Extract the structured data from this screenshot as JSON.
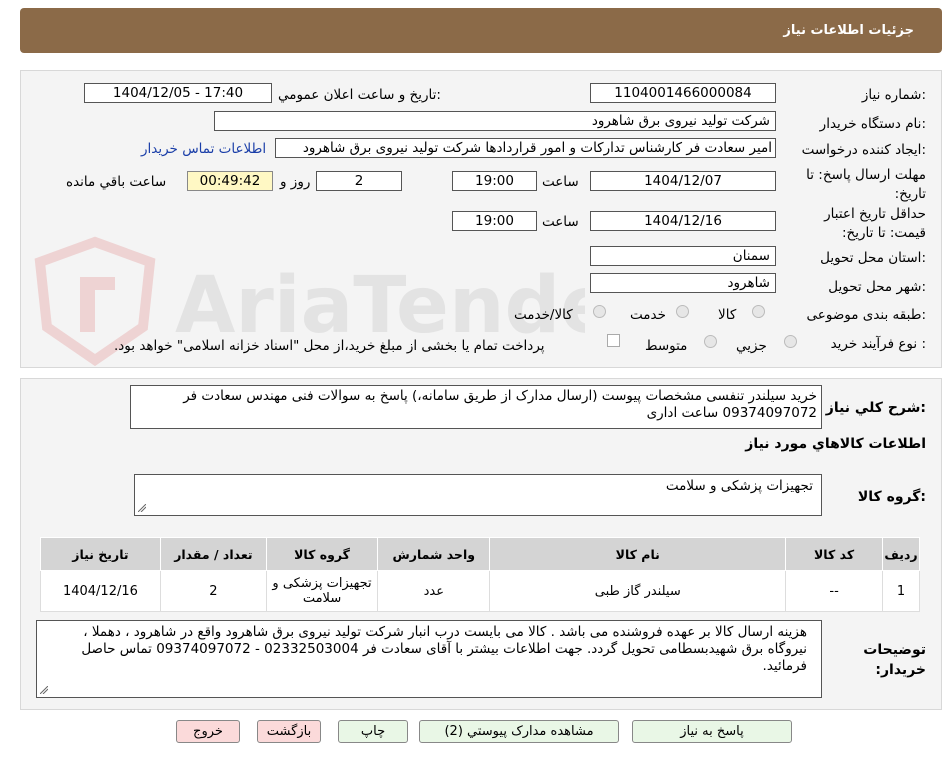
{
  "header": {
    "title": "جزئیات اطلاعات نیاز"
  },
  "watermark": {
    "text": "AriaTender.neT"
  },
  "form": {
    "need_number_label": "شماره نیاز:",
    "need_number": "1104001466000084",
    "announce_label": "تاریخ و ساعت اعلان عمومي:",
    "announce_value": "1404/12/05 - 17:40",
    "buyer_org_label": "نام دستگاه خريدار:",
    "buyer_org": "شرکت تولید نیروی برق شاهرود",
    "requester_label": "ايجاد کننده درخواست:",
    "requester": "امیر سعادت فر کارشناس تدارکات و امور قراردادها شرکت تولید نیروی برق شاهرود",
    "buyer_contact_link": "اطلاعات تماس خريدار",
    "reply_deadline_label": "مهلت ارسال پاسخ: تا تاریخ:",
    "reply_date": "1404/12/07",
    "time_label": "ساعت",
    "reply_time": "19:00",
    "days_value": "2",
    "days_label": "روز و",
    "remaining_time": "00:49:42",
    "remaining_label": "ساعت باقي مانده",
    "validity_label": "حداقل تاريخ اعتبار قيمت: تا تاريخ:",
    "validity_date": "1404/12/16",
    "validity_time": "19:00",
    "province_label": "استان محل تحويل:",
    "province": "سمنان",
    "city_label": "شهر محل تحويل:",
    "city": "شاهرود",
    "category_label": "طبقه بندی موضوعی:",
    "category_options": [
      "کالا",
      "خدمت",
      "کالا/خدمت"
    ],
    "purchase_type_label": "نوع فرآيند خريد :",
    "purchase_options": [
      "جزيي",
      "متوسط"
    ],
    "payment_note": "پرداخت تمام يا بخشی از مبلغ خريد،از محل \"اسناد خزانه اسلامی\" خواهد بود."
  },
  "summary": {
    "label": "شرح کلي نياز:",
    "text": "خرید سیلندر تنفسی مشخصات پیوست (ارسال مدارک از طریق سامانه،) پاسخ به سوالات فنی مهندس سعادت فر 09374097072 ساعت اداری"
  },
  "goods": {
    "section_title": "اطلاعات کالاهاي مورد نياز",
    "group_label": "گروه کالا:",
    "group_value": "تجهیزات پزشکی و سلامت",
    "table": {
      "headers": [
        "رديف",
        "کد کالا",
        "نام کالا",
        "واحد شمارش",
        "گروه کالا",
        "تعداد / مقدار",
        "تاريخ نياز"
      ],
      "rows": [
        [
          "1",
          "--",
          "سیلندر گاز طبی",
          "عدد",
          "تجهیزات پزشکی و سلامت",
          "2",
          "1404/12/16"
        ]
      ]
    }
  },
  "buyer_notes": {
    "label": "توضيحات خريدار:",
    "text": "هزینه ارسال کالا بر عهده فروشنده می باشد . کالا می بایست درب انبار شرکت تولید نیروی برق شاهرود واقع در شاهرود ، دهملا ، نیروگاه برق شهیدبسطامی تحویل گردد. جهت اطلاعات بیشتر با آقای سعادت فر  02332503004 - 09374097072 تماس حاصل فرمائید."
  },
  "buttons": {
    "reply": "پاسخ به نياز",
    "attachments": "مشاهده مدارک پيوستي (2)",
    "print": "چاپ",
    "back": "بازگشت",
    "exit": "خروج"
  }
}
